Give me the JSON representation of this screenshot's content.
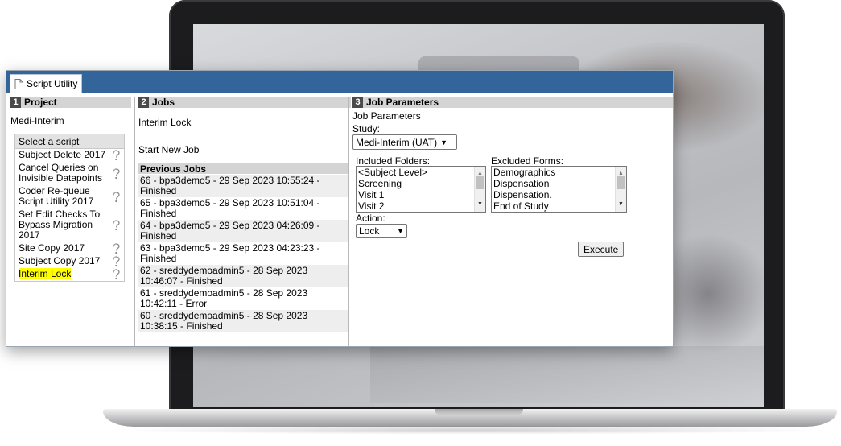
{
  "tab": {
    "label": "Script Utility",
    "icon": "document-icon"
  },
  "project": {
    "num": "1",
    "heading": "Project",
    "name": "Medi-Interim",
    "panel_title": "Select a script",
    "scripts": [
      {
        "label": "Subject Delete 2017",
        "selected": false
      },
      {
        "label": "Cancel Queries on Invisible Datapoints",
        "selected": false
      },
      {
        "label": "Coder Re-queue Script Utility 2017",
        "selected": false
      },
      {
        "label": "Set Edit Checks To Bypass Migration 2017",
        "selected": false
      },
      {
        "label": "Site Copy 2017",
        "selected": false
      },
      {
        "label": "Subject Copy 2017",
        "selected": false
      },
      {
        "label": "Interim Lock",
        "selected": true
      }
    ],
    "highlight_color": "#ffff00"
  },
  "jobs": {
    "num": "2",
    "heading": "Jobs",
    "name": "Interim Lock",
    "start_new": "Start New Job",
    "previous_heading": "Previous Jobs",
    "items": [
      "66 - bpa3demo5 - 29 Sep 2023 10:55:24 - Finished",
      "65 - bpa3demo5 - 29 Sep 2023 10:51:04 - Finished",
      "64 - bpa3demo5 - 29 Sep 2023 04:26:09 - Finished",
      "63 - bpa3demo5 - 29 Sep 2023 04:23:23 - Finished",
      "62 - sreddydemoadmin5 - 28 Sep 2023 10:46:07 - Finished",
      "61 - sreddydemoadmin5 - 28 Sep 2023 10:42:11 - Error",
      "60 - sreddydemoadmin5 - 28 Sep 2023 10:38:15 - Finished"
    ]
  },
  "params": {
    "num": "3",
    "heading": "Job Parameters",
    "subheading": "Job Parameters",
    "study_label": "Study:",
    "study_value": "Medi-Interim (UAT)",
    "included_label": "Included Folders:",
    "included_items": [
      "<Subject Level>",
      "Screening",
      "Visit 1",
      "Visit 2"
    ],
    "excluded_label": "Excluded Forms:",
    "excluded_items": [
      "Demographics",
      "Dispensation",
      "Dispensation.",
      "End of Study"
    ],
    "action_label": "Action:",
    "action_value": "Lock",
    "execute_label": "Execute"
  },
  "colors": {
    "header_bar": "#34659a",
    "section_header": "#d4d4d4"
  }
}
